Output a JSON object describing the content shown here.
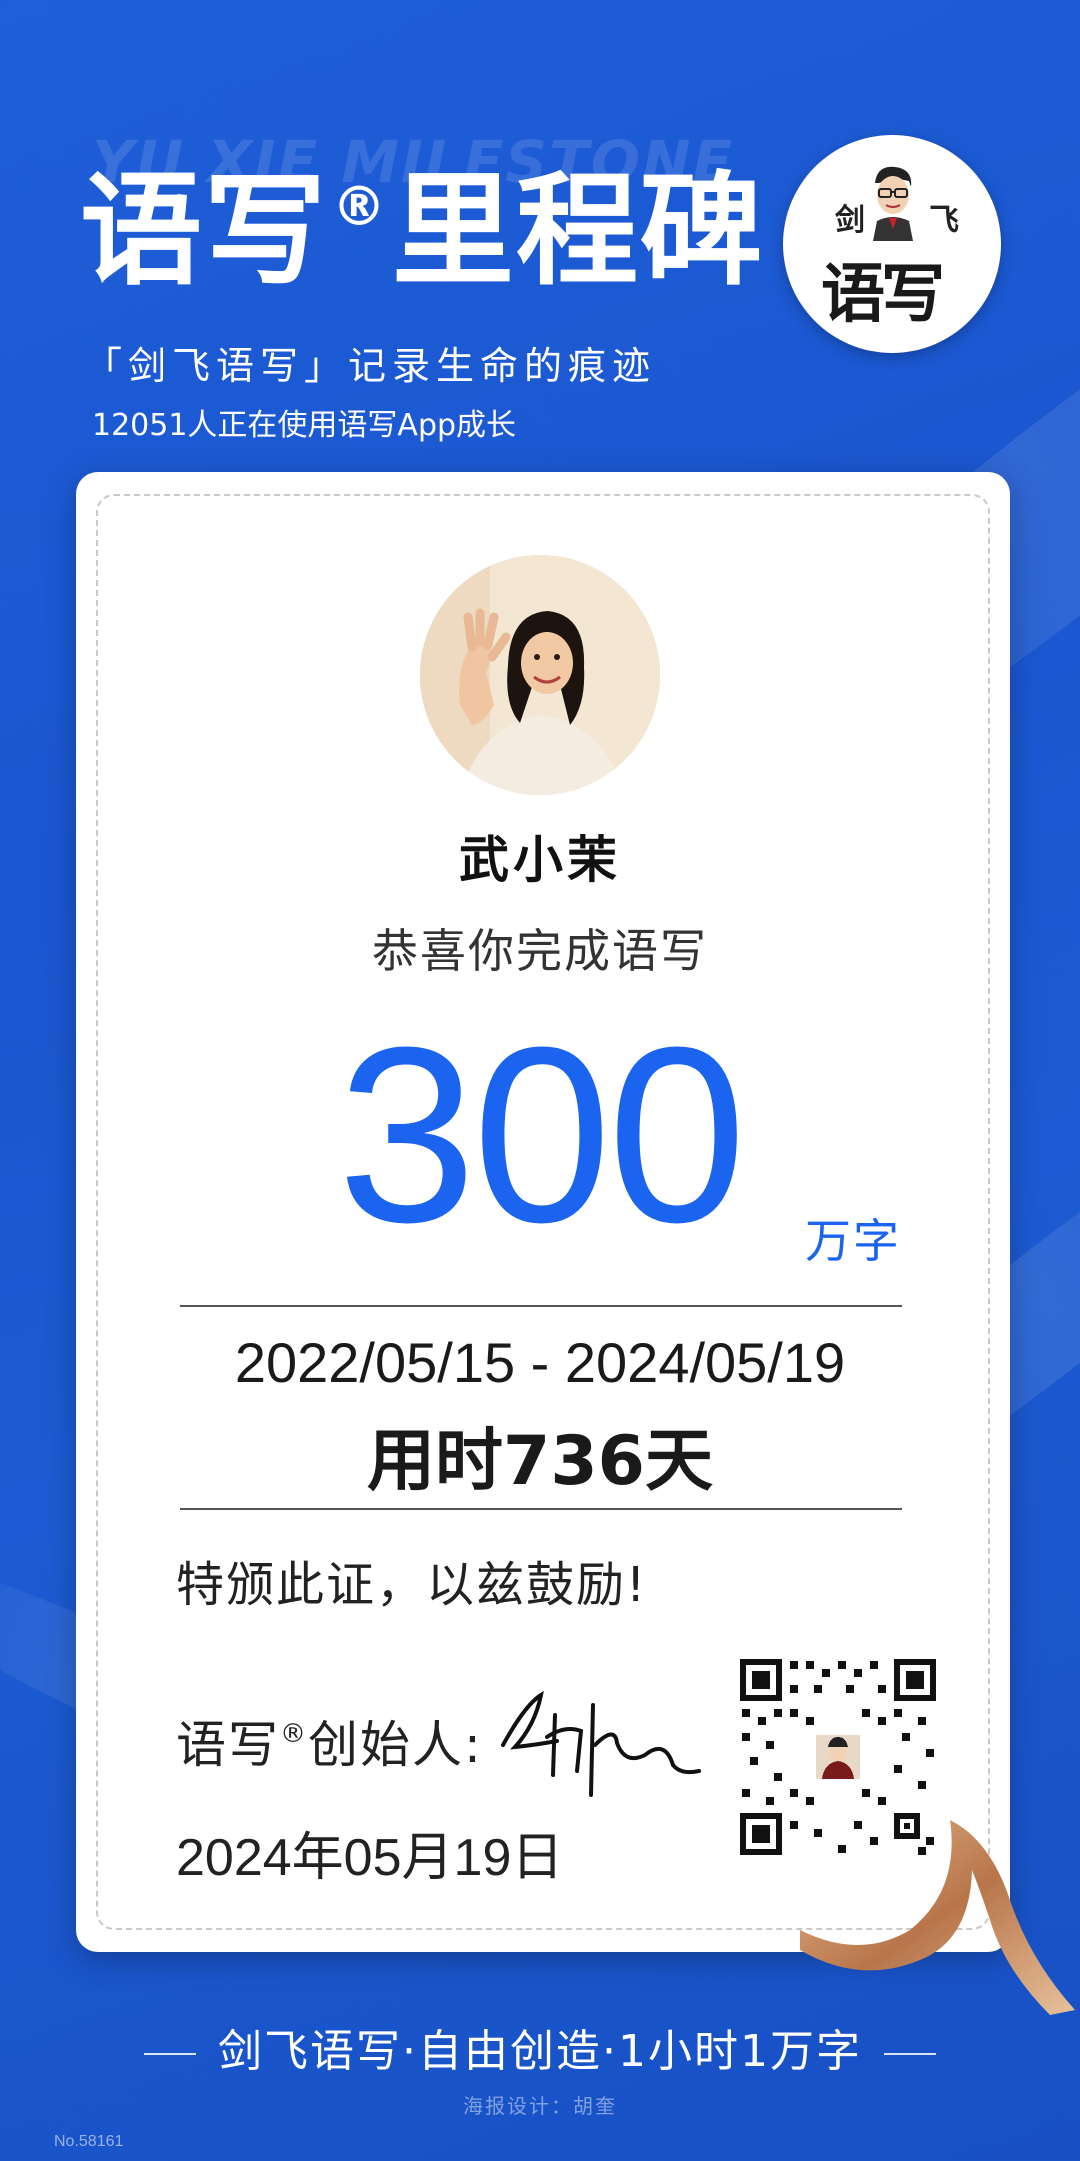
{
  "header": {
    "watermark": "YU XIE MILESTONE",
    "title_part1": "语写",
    "title_reg": "®",
    "title_part2": "里程碑",
    "subtitle": "「剑飞语写」记录生命的痕迹",
    "users_line": "12051人正在使用语写App成长"
  },
  "logo": {
    "left_char": "剑",
    "right_char": "飞",
    "main_text": "语写"
  },
  "certificate": {
    "name": "武小茉",
    "congrats": "恭喜你完成语写",
    "amount": "300",
    "unit": "万字",
    "date_range": "2022/05/15 - 2024/05/19",
    "duration": "用时736天",
    "certify_text": "特颁此证，以兹鼓励!",
    "founder_label": "语写",
    "founder_reg": "®",
    "founder_suffix": "创始人:",
    "issue_date": "2024年05月19日"
  },
  "footer": {
    "slogan": "剑飞语写·自由创造·1小时1万字",
    "designer": "海报设计：胡奎",
    "serial": "No.58161"
  },
  "colors": {
    "background": "#1c5bd3",
    "accent_blue": "#1b64ef",
    "ribbon": "#c98a5a"
  },
  "icons": {
    "avatar": "user-photo",
    "logo": "founder-portrait-logo",
    "qr": "qr-code",
    "signature": "handwritten-signature"
  }
}
